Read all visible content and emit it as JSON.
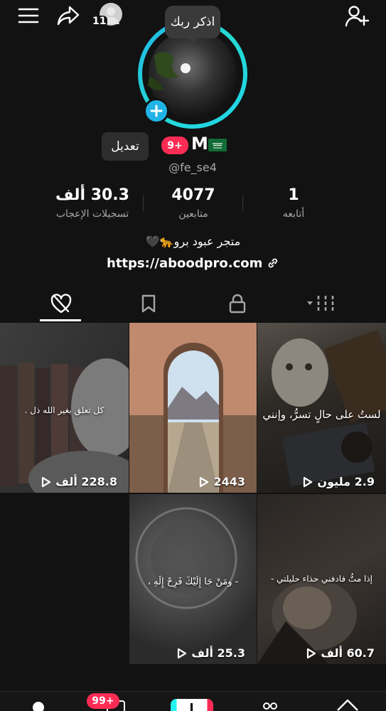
{
  "header": {
    "notification_count": "11",
    "story_bubble": "اذكر ربك"
  },
  "profile": {
    "display_name": "M",
    "flag_emoji": "🇸🇦",
    "badge": "9+",
    "username": "@fe_se4",
    "edit_label": "تعديل",
    "bio": "متجر عبود برو🐆🖤",
    "link": "https://aboodpro.com"
  },
  "stats": {
    "likes_value": "30.3 ألف",
    "likes_label": "تسجيلات الإعجاب",
    "followers_value": "4077",
    "followers_label": "متابعين",
    "following_value": "1",
    "following_label": "أتابعه"
  },
  "videos": [
    {
      "views": "2.9 مليون",
      "overlay": "لستُ على حالٍ تسرُّ، وإنني"
    },
    {
      "views": "2443",
      "overlay": ""
    },
    {
      "views": "228.8 ألف",
      "overlay": "كل تعلق بغير الله ذل ."
    },
    {
      "views": "60.7 ألف",
      "overlay": "إذا متُّ فادفني حذاء حليلتي -"
    },
    {
      "views": "25.3 ألف",
      "overlay": "- ومَنْ جَا إِلَيْكَ فَرِحْ إِلَهِ ،"
    }
  ],
  "bottom_nav": {
    "inbox_badge": "99+"
  },
  "colors": {
    "background": "#121212",
    "accent_red": "#fe2c55",
    "accent_cyan": "#25f4ee",
    "story_ring": "#20d5ec"
  }
}
